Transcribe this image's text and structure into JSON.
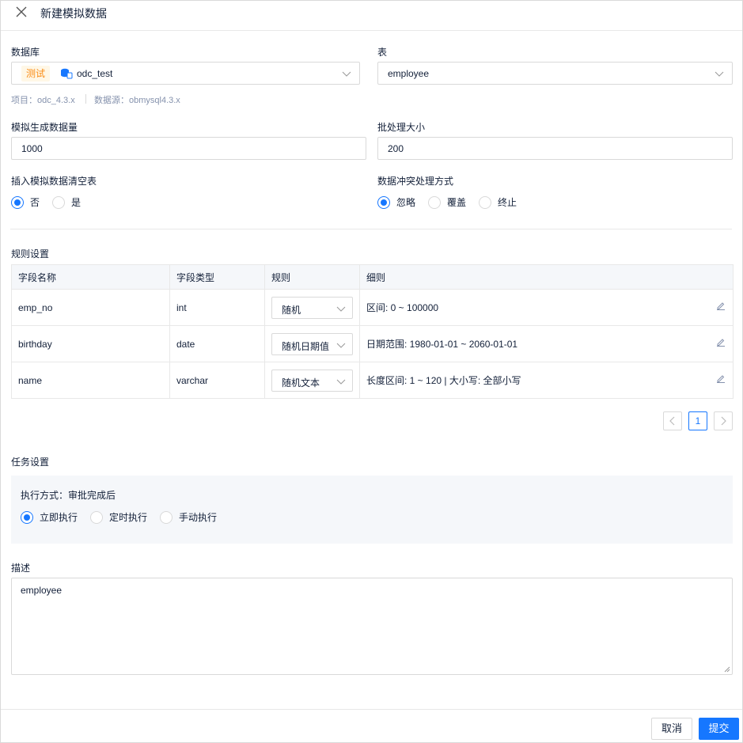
{
  "title": "新建模拟数据",
  "database": {
    "label": "数据库",
    "env_tag": "测试",
    "value": "odc_test",
    "meta_project": "项目：odc_4.3.x",
    "meta_source": "数据源：obmysql4.3.x"
  },
  "table": {
    "label": "表",
    "value": "employee"
  },
  "row_count": {
    "label": "模拟生成数据量",
    "value": "1000"
  },
  "batch_size": {
    "label": "批处理大小",
    "value": "200"
  },
  "clear_table": {
    "label": "插入模拟数据清空表",
    "options": [
      "否",
      "是"
    ],
    "selected": "否"
  },
  "conflict": {
    "label": "数据冲突处理方式",
    "options": [
      "忽略",
      "覆盖",
      "终止"
    ],
    "selected": "忽略"
  },
  "rules": {
    "label": "规则设置",
    "columns": [
      "字段名称",
      "字段类型",
      "规则",
      "细则"
    ],
    "rows": [
      {
        "name": "emp_no",
        "type": "int",
        "rule": "随机",
        "detail": "区间: 0 ~ 100000"
      },
      {
        "name": "birthday",
        "type": "date",
        "rule": "随机日期值",
        "detail": "日期范围: 1980-01-01 ~ 2060-01-01"
      },
      {
        "name": "name",
        "type": "varchar",
        "rule": "随机文本",
        "detail": "长度区间: 1 ~ 120 | 大小写: 全部小写"
      }
    ],
    "page": "1"
  },
  "task": {
    "label": "任务设置",
    "exec_mode": "执行方式：审批完成后",
    "options": [
      "立即执行",
      "定时执行",
      "手动执行"
    ],
    "selected": "立即执行"
  },
  "description": {
    "label": "描述",
    "value": "employee"
  },
  "footer": {
    "cancel": "取消",
    "submit": "提交"
  },
  "colors": {
    "primary": "#1677ff",
    "tag_bg": "#fff7e6",
    "tag_text": "#fa8c16"
  }
}
